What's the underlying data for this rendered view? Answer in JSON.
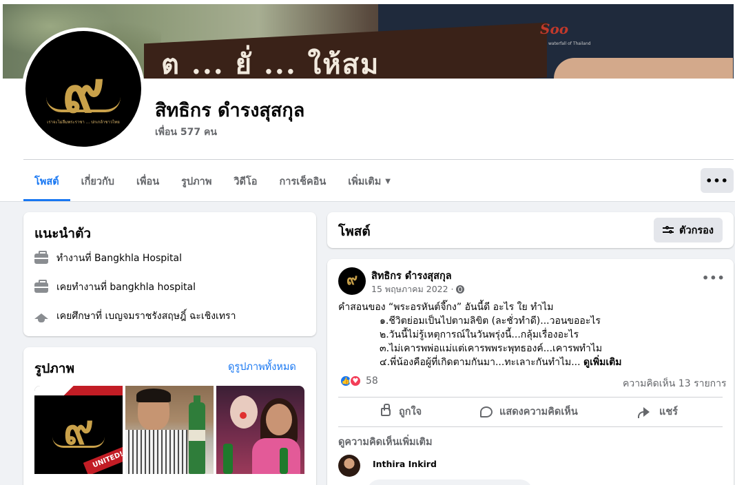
{
  "profile": {
    "name": "สิทธิกร ดำรงสุสกุล",
    "friends": "เพื่อน 577 คน"
  },
  "tabs": [
    {
      "label": "โพสต์",
      "active": true
    },
    {
      "label": "เกี่ยวกับ"
    },
    {
      "label": "เพื่อน"
    },
    {
      "label": "รูปภาพ"
    },
    {
      "label": "วิดีโอ"
    },
    {
      "label": "การเช็คอิน"
    },
    {
      "label": "เพิ่มเติม"
    }
  ],
  "more_button": "•••",
  "intro": {
    "title": "แนะนำตัว",
    "items": [
      {
        "icon": "briefcase-icon",
        "text": "ทำงานที่ Bangkhla Hospital"
      },
      {
        "icon": "briefcase-icon",
        "text": "เคยทำงานที่ bangkhla hospital"
      },
      {
        "icon": "graduation-cap-icon",
        "text": "เคยศึกษาที่ เบญจมราชรังสฤษฎิ์ ฉะเชิงเทรา"
      }
    ]
  },
  "photos": {
    "title": "รูปภาพ",
    "see_all": "ดูรูปภาพทั้งหมด",
    "badge": "UNITED!"
  },
  "posts_header": {
    "title": "โพสต์",
    "filter_label": "ตัวกรอง"
  },
  "post": {
    "author": "สิทธิกร ดำรงสุสกุล",
    "date": "15 พฤษภาคม 2022 ·",
    "menu": "•••",
    "lines": [
      "คำสอนของ “พระอรหันต์จี๊กง” อันนี้ดี อะไร ใย ทำไม",
      "๑.ชีวิตย่อมเป็นไปตามลิขิต (ละชั่วทำดี)...วอนขออะไร",
      "๒.วันนี้ไม่รู้เหตุการณ์ในวันพรุ่งนี้...กลุ้มเรื่องอะไร",
      "๓.ไม่เคารพพ่อแม่แต่เคารพพระพุทธองค์...เคารพทำไม",
      "๔.พี่น้องคือผู้ที่เกิดตามกันมา...ทะเลาะกันทำไม..."
    ],
    "see_more": "ดูเพิ่มเติม",
    "reaction_count": "58",
    "comment_count": "ความคิดเห็น 13 รายการ",
    "actions": {
      "like": "ถูกใจ",
      "comment": "แสดงความคิดเห็น",
      "share": "แชร์"
    },
    "view_more_comments": "ดูความคิดเห็นเพิ่มเติม",
    "commenter": "Inthira Inkird"
  },
  "colors": {
    "accent": "#1877f2",
    "background": "#f0f2f5",
    "secondary_text": "#65676b"
  }
}
